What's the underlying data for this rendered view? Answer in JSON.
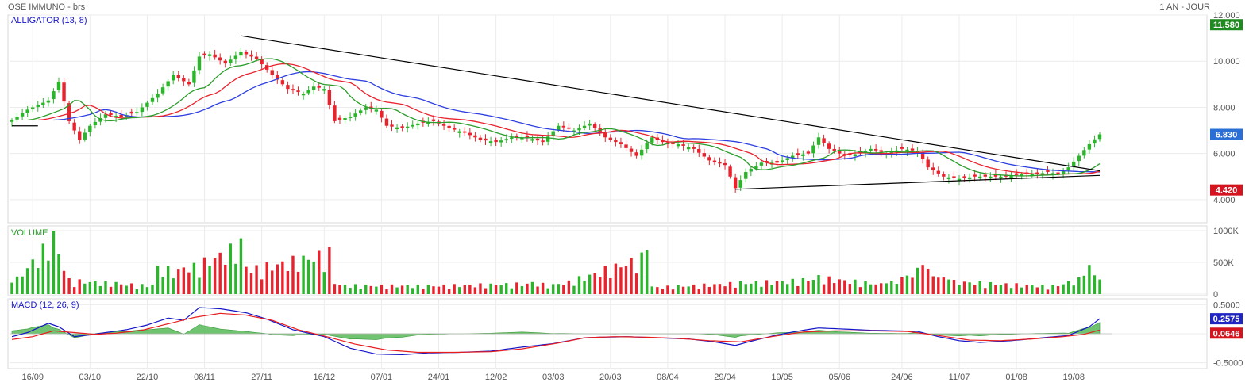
{
  "header": {
    "instrument": "OSE IMMUNO - brs",
    "period": "1 AN - JOUR"
  },
  "panels": {
    "price": {
      "label": "ALLIGATOR (13, 8)"
    },
    "volume": {
      "label": "VOLUME"
    },
    "macd": {
      "label": "MACD (12, 26, 9)"
    }
  },
  "badges": {
    "high": "11.580",
    "last": "6.830",
    "low": "4.420",
    "macd": "0.2575",
    "signal": "0.0646"
  },
  "colors": {
    "up": "#2bb52b",
    "down": "#e8232d",
    "jaw": "#2d3fe0",
    "teeth": "#e8232d",
    "lips": "#2a9d2a",
    "trendline": "#000000",
    "macd_line": "#1515c8",
    "signal_line": "#e81e1e",
    "histogram": "#57b857",
    "badge_high": "#1f8a1f",
    "badge_last": "#2a6fd6",
    "badge_low": "#d4141e",
    "badge_macd": "#1f25c0",
    "badge_signal": "#d4141e"
  },
  "chart_data": {
    "type": "candlestick",
    "x_tick_labels": [
      "16/09",
      "03/10",
      "22/10",
      "08/11",
      "27/11",
      "16/12",
      "07/01",
      "24/01",
      "12/02",
      "03/03",
      "20/03",
      "08/04",
      "29/04",
      "19/05",
      "05/06",
      "24/06",
      "11/07",
      "01/08",
      "19/08"
    ],
    "price_axis": {
      "ticks": [
        "12.000",
        "10.000",
        "8.000",
        "6.000",
        "4.000"
      ],
      "ylim": [
        3.0,
        12.0
      ]
    },
    "volume_axis": {
      "ticks": [
        "1000K",
        "500K",
        "0"
      ],
      "ylim": [
        0,
        1000000
      ]
    },
    "macd_axis": {
      "ticks": [
        "0.5000",
        "0",
        "-0.5000"
      ],
      "ylim": [
        -0.6,
        0.6
      ]
    },
    "price_anchors": [
      [
        0,
        7.45
      ],
      [
        3,
        7.9
      ],
      [
        7,
        8.3
      ],
      [
        9,
        9.1
      ],
      [
        11,
        7.4
      ],
      [
        13,
        6.6
      ],
      [
        15,
        7.2
      ],
      [
        18,
        7.7
      ],
      [
        21,
        7.6
      ],
      [
        24,
        7.8
      ],
      [
        28,
        8.6
      ],
      [
        31,
        9.4
      ],
      [
        34,
        9.0
      ],
      [
        36,
        10.2
      ],
      [
        38,
        10.3
      ],
      [
        41,
        9.9
      ],
      [
        44,
        10.4
      ],
      [
        47,
        10.1
      ],
      [
        50,
        9.4
      ],
      [
        53,
        8.8
      ],
      [
        56,
        8.6
      ],
      [
        58,
        8.9
      ],
      [
        60,
        8.8
      ],
      [
        62,
        7.4
      ],
      [
        65,
        7.6
      ],
      [
        68,
        8.0
      ],
      [
        70,
        7.9
      ],
      [
        72,
        7.2
      ],
      [
        75,
        7.1
      ],
      [
        78,
        7.3
      ],
      [
        81,
        7.4
      ],
      [
        84,
        7.1
      ],
      [
        87,
        6.9
      ],
      [
        90,
        6.6
      ],
      [
        93,
        6.5
      ],
      [
        96,
        6.7
      ],
      [
        99,
        6.7
      ],
      [
        102,
        6.5
      ],
      [
        105,
        7.2
      ],
      [
        108,
        7.0
      ],
      [
        111,
        7.3
      ],
      [
        114,
        6.7
      ],
      [
        117,
        6.4
      ],
      [
        120,
        5.9
      ],
      [
        123,
        6.7
      ],
      [
        126,
        6.4
      ],
      [
        128,
        6.4
      ],
      [
        131,
        6.2
      ],
      [
        134,
        5.7
      ],
      [
        137,
        5.5
      ],
      [
        139,
        4.5
      ],
      [
        141,
        5.2
      ],
      [
        144,
        5.6
      ],
      [
        147,
        5.6
      ],
      [
        150,
        5.9
      ],
      [
        153,
        6.0
      ],
      [
        155,
        6.7
      ],
      [
        157,
        6.2
      ],
      [
        160,
        5.9
      ],
      [
        163,
        6.0
      ],
      [
        165,
        6.2
      ],
      [
        168,
        6.0
      ],
      [
        171,
        6.2
      ],
      [
        174,
        6.1
      ],
      [
        176,
        5.4
      ],
      [
        179,
        5.0
      ],
      [
        182,
        4.9
      ],
      [
        185,
        5.0
      ],
      [
        188,
        5.0
      ],
      [
        191,
        5.0
      ],
      [
        194,
        5.1
      ],
      [
        197,
        5.1
      ],
      [
        199,
        5.2
      ],
      [
        201,
        5.1
      ],
      [
        203,
        5.4
      ],
      [
        205,
        5.9
      ],
      [
        207,
        6.4
      ],
      [
        209,
        6.83
      ]
    ],
    "volume_anchors": [
      [
        0,
        180000
      ],
      [
        8,
        1000000
      ],
      [
        11,
        250000
      ],
      [
        20,
        190000
      ],
      [
        27,
        150000
      ],
      [
        28,
        450000
      ],
      [
        33,
        420000
      ],
      [
        44,
        880000
      ],
      [
        45,
        430000
      ],
      [
        61,
        740000
      ],
      [
        62,
        160000
      ],
      [
        80,
        150000
      ],
      [
        100,
        190000
      ],
      [
        105,
        160000
      ],
      [
        122,
        690000
      ],
      [
        123,
        120000
      ],
      [
        140,
        200000
      ],
      [
        152,
        250000
      ],
      [
        155,
        300000
      ],
      [
        168,
        170000
      ],
      [
        175,
        460000
      ],
      [
        180,
        230000
      ],
      [
        200,
        140000
      ],
      [
        206,
        290000
      ],
      [
        207,
        460000
      ],
      [
        209,
        230000
      ]
    ],
    "macd_anchors": [
      [
        0,
        -0.05
      ],
      [
        3,
        0.02
      ],
      [
        7,
        0.18
      ],
      [
        9,
        0.12
      ],
      [
        12,
        -0.05
      ],
      [
        15,
        -0.02
      ],
      [
        18,
        0.02
      ],
      [
        22,
        0.07
      ],
      [
        26,
        0.15
      ],
      [
        30,
        0.27
      ],
      [
        33,
        0.23
      ],
      [
        36,
        0.45
      ],
      [
        40,
        0.43
      ],
      [
        45,
        0.36
      ],
      [
        49,
        0.25
      ],
      [
        54,
        0.07
      ],
      [
        60,
        -0.05
      ],
      [
        65,
        -0.25
      ],
      [
        70,
        -0.35
      ],
      [
        75,
        -0.36
      ],
      [
        80,
        -0.33
      ],
      [
        86,
        -0.32
      ],
      [
        92,
        -0.3
      ],
      [
        98,
        -0.23
      ],
      [
        104,
        -0.17
      ],
      [
        110,
        -0.07
      ],
      [
        113,
        -0.06
      ],
      [
        118,
        -0.05
      ],
      [
        124,
        -0.07
      ],
      [
        130,
        -0.09
      ],
      [
        135,
        -0.14
      ],
      [
        139,
        -0.2
      ],
      [
        142,
        -0.13
      ],
      [
        147,
        -0.02
      ],
      [
        152,
        0.06
      ],
      [
        155,
        0.1
      ],
      [
        160,
        0.08
      ],
      [
        165,
        0.06
      ],
      [
        170,
        0.05
      ],
      [
        174,
        0.04
      ],
      [
        178,
        -0.05
      ],
      [
        182,
        -0.12
      ],
      [
        186,
        -0.15
      ],
      [
        192,
        -0.12
      ],
      [
        198,
        -0.07
      ],
      [
        203,
        -0.03
      ],
      [
        207,
        0.12
      ],
      [
        209,
        0.2575
      ]
    ],
    "signal_anchors": [
      [
        0,
        -0.1
      ],
      [
        4,
        -0.05
      ],
      [
        8,
        0.05
      ],
      [
        12,
        0.02
      ],
      [
        16,
        -0.01
      ],
      [
        20,
        0.01
      ],
      [
        25,
        0.06
      ],
      [
        30,
        0.17
      ],
      [
        35,
        0.28
      ],
      [
        40,
        0.35
      ],
      [
        45,
        0.32
      ],
      [
        50,
        0.23
      ],
      [
        55,
        0.07
      ],
      [
        60,
        -0.04
      ],
      [
        66,
        -0.18
      ],
      [
        72,
        -0.28
      ],
      [
        78,
        -0.32
      ],
      [
        85,
        -0.32
      ],
      [
        92,
        -0.31
      ],
      [
        98,
        -0.26
      ],
      [
        105,
        -0.16
      ],
      [
        110,
        -0.07
      ],
      [
        116,
        -0.05
      ],
      [
        122,
        -0.06
      ],
      [
        128,
        -0.08
      ],
      [
        134,
        -0.12
      ],
      [
        140,
        -0.14
      ],
      [
        146,
        -0.05
      ],
      [
        152,
        0.03
      ],
      [
        158,
        0.05
      ],
      [
        165,
        0.05
      ],
      [
        172,
        0.04
      ],
      [
        178,
        -0.03
      ],
      [
        184,
        -0.11
      ],
      [
        190,
        -0.12
      ],
      [
        196,
        -0.09
      ],
      [
        202,
        -0.05
      ],
      [
        206,
        -0.01
      ],
      [
        209,
        0.0646
      ]
    ],
    "trendlines": [
      {
        "from": [
          44,
          11.1
        ],
        "to": [
          209,
          5.25
        ]
      },
      {
        "from": [
          139,
          4.45
        ],
        "to": [
          209,
          5.05
        ]
      },
      {
        "from": [
          0,
          7.2
        ],
        "to": [
          5,
          7.2
        ]
      }
    ]
  }
}
